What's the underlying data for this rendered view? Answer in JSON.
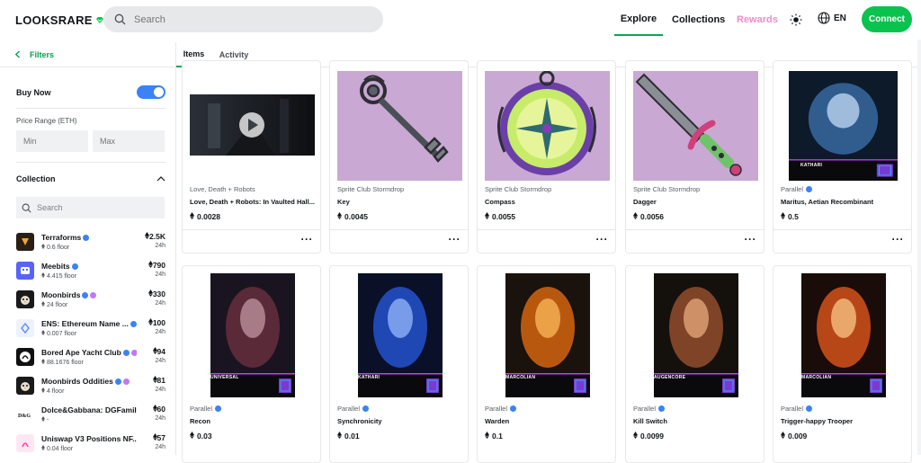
{
  "header": {
    "logo": "LOOKSRARE",
    "search_placeholder": "Search",
    "nav": {
      "explore": "Explore",
      "collections": "Collections",
      "rewards": "Rewards"
    },
    "language": "EN",
    "connect": "Connect"
  },
  "sidebar": {
    "filters_label": "Filters",
    "buy_now_label": "Buy Now",
    "buy_now_enabled": true,
    "price_range_label": "Price Range (ETH)",
    "min_placeholder": "Min",
    "max_placeholder": "Max",
    "collection_label": "Collection",
    "collection_search_placeholder": "Search",
    "collections": [
      {
        "name": "Terraforms",
        "floor": "0.6 floor",
        "volume": "2.5K",
        "period": "24h",
        "color": "#2a1f14",
        "verified": true,
        "badge2": false
      },
      {
        "name": "Meebits",
        "floor": "4.415 floor",
        "volume": "790",
        "period": "24h",
        "color": "#5865f2",
        "verified": true,
        "badge2": false
      },
      {
        "name": "Moonbirds",
        "floor": "24 floor",
        "volume": "330",
        "period": "24h",
        "color": "#1a1a1a",
        "verified": true,
        "badge2": true
      },
      {
        "name": "ENS: Ethereum Name ...",
        "floor": "0.007 floor",
        "volume": "100",
        "period": "24h",
        "color": "#eef2ff",
        "verified": true,
        "badge2": false
      },
      {
        "name": "Bored Ape Yacht Club",
        "floor": "88.1676 floor",
        "volume": "94",
        "period": "24h",
        "color": "#111111",
        "verified": true,
        "badge2": true
      },
      {
        "name": "Moonbirds Oddities",
        "floor": "4 floor",
        "volume": "81",
        "period": "24h",
        "color": "#1a1a1a",
        "verified": true,
        "badge2": true
      },
      {
        "name": "Dolce&Gabbana: DGFamily",
        "floor": "-",
        "volume": "60",
        "period": "24h",
        "color": "#ffffff",
        "verified": false,
        "badge2": false
      },
      {
        "name": "Uniswap V3 Positions NF...",
        "floor": "0.04 floor",
        "volume": "57",
        "period": "24h",
        "color": "#fde7f3",
        "verified": false,
        "badge2": false
      }
    ]
  },
  "tabs": {
    "items": "Items",
    "activity": "Activity"
  },
  "cards": [
    {
      "collection": "Love, Death + Robots",
      "name": "Love, Death + Robots: In Vaulted Hall...",
      "price": "0.0028",
      "verified": false,
      "art": "video"
    },
    {
      "collection": "Sprite Club Stormdrop",
      "name": "Key",
      "price": "0.0045",
      "verified": false,
      "art": "key"
    },
    {
      "collection": "Sprite Club Stormdrop",
      "name": "Compass",
      "price": "0.0055",
      "verified": false,
      "art": "compass"
    },
    {
      "collection": "Sprite Club Stormdrop",
      "name": "Dagger",
      "price": "0.0056",
      "verified": false,
      "art": "dagger"
    },
    {
      "collection": "Parallel",
      "name": "Maritus, Aetian Recombinant",
      "price": "0.5",
      "verified": true,
      "art": "parallel1"
    },
    {
      "collection": "Parallel",
      "name": "Recon",
      "price": "0.03",
      "verified": true,
      "art": "parallel2"
    },
    {
      "collection": "Parallel",
      "name": "Synchronicity",
      "price": "0.01",
      "verified": true,
      "art": "parallel3"
    },
    {
      "collection": "Parallel",
      "name": "Warden",
      "price": "0.1",
      "verified": true,
      "art": "parallel4"
    },
    {
      "collection": "Parallel",
      "name": "Kill Switch",
      "price": "0.0099",
      "verified": true,
      "art": "parallel5"
    },
    {
      "collection": "Parallel",
      "name": "Trigger-happy Trooper",
      "price": "0.009",
      "verified": true,
      "art": "parallel6"
    }
  ],
  "card_art_text": {
    "parallel1": "KATHARI",
    "parallel2": "UNIVERSAL",
    "parallel3": "KATHARI",
    "parallel4": "MARCOLIAN",
    "parallel5": "AUGENCORE",
    "parallel6": "MARCOLIAN"
  },
  "more_label": "···",
  "colors": {
    "brand_green": "#0ac24e",
    "accent_blue": "#3b82f6",
    "rewards_pink": "#f08cc8",
    "sprite_bg": "#c9a8d4"
  }
}
